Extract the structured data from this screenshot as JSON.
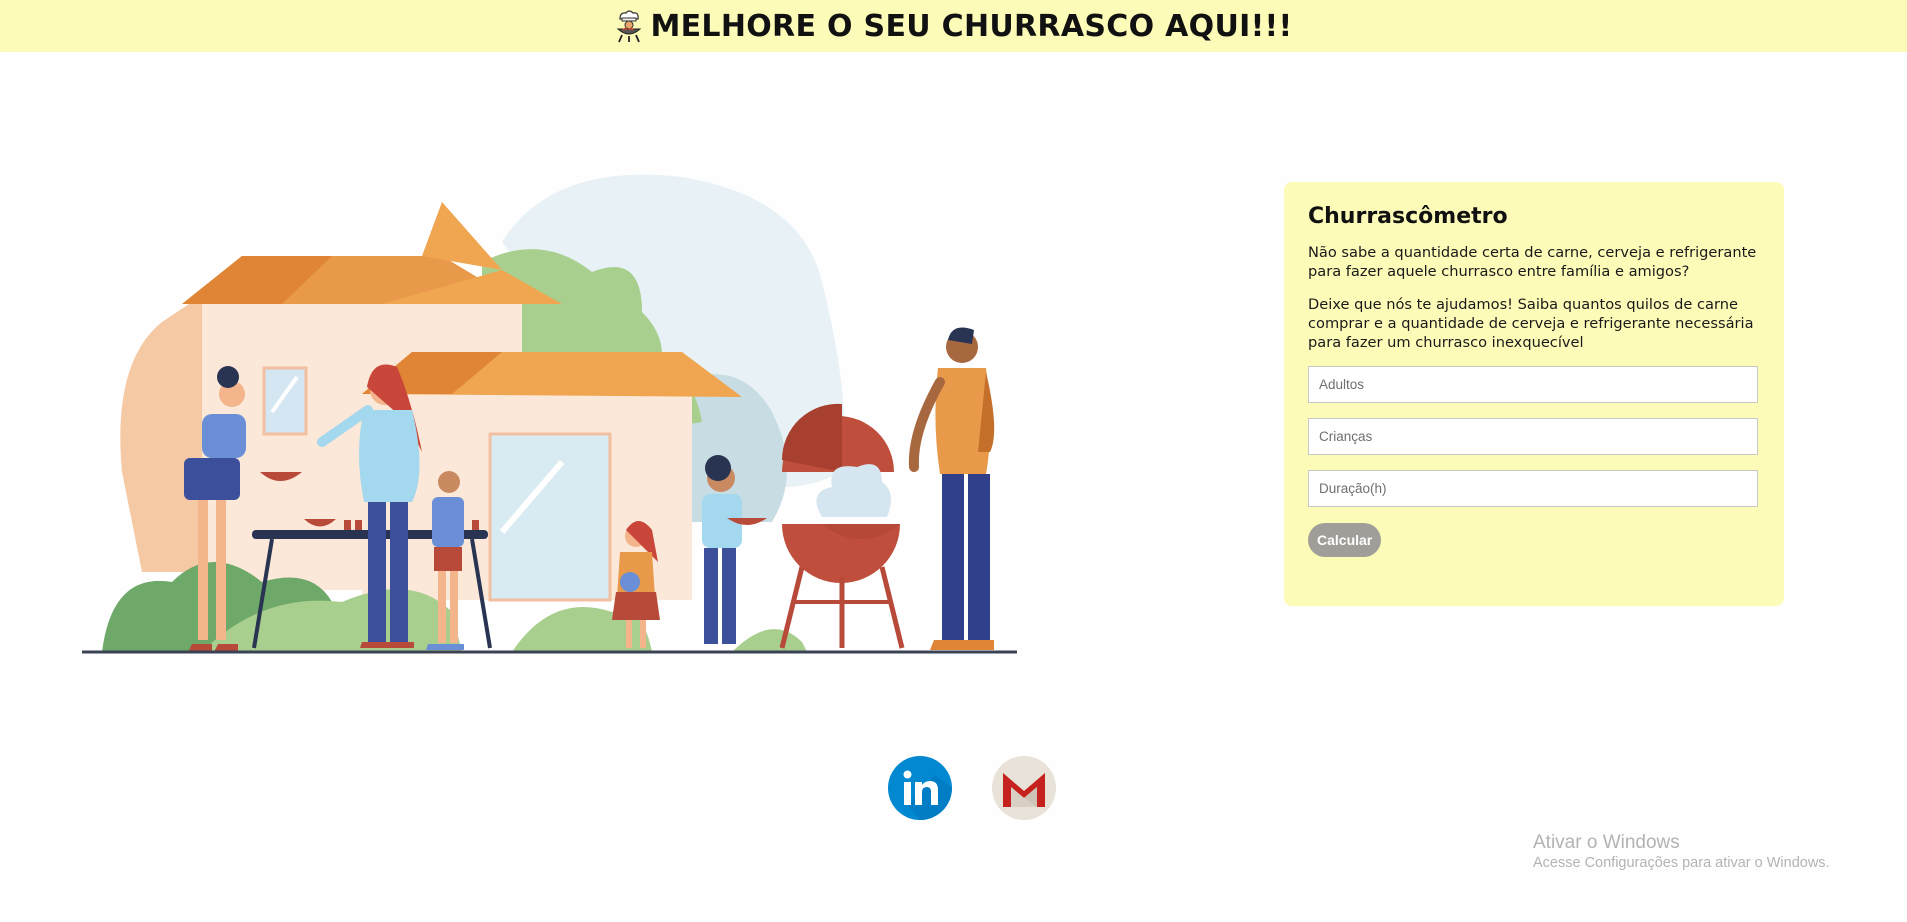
{
  "header": {
    "title": "MELHORE O SEU CHURRASCO AQUI!!!",
    "logo_icon": "grill-chef-icon",
    "background": "#fdfbb8"
  },
  "illustration": {
    "icon": "family-barbecue-illustration"
  },
  "form": {
    "title": "Churrascômetro",
    "intro": "Não sabe a quantidade certa de carne, cerveja e refrigerante para fazer aquele churrasco entre família e amigos?",
    "description": "Deixe que nós te ajudamos! Saiba quantos quilos de carne comprar e a quantidade de cerveja e refrigerante necessária para fazer um churrasco inexquecível",
    "fields": {
      "adults": {
        "placeholder": "Adultos",
        "value": ""
      },
      "children": {
        "placeholder": "Crianças",
        "value": ""
      },
      "duration": {
        "placeholder": "Duração(h)",
        "value": ""
      }
    },
    "submit_label": "Calcular",
    "background": "#fdfbb8"
  },
  "social": {
    "linkedin_icon": "linkedin-icon",
    "linkedin_color": "#0288d1",
    "gmail_icon": "gmail-icon",
    "gmail_color": "#c5221f"
  },
  "watermark": {
    "line1": "Ativar o Windows",
    "line2": "Acesse Configurações para ativar o Windows."
  }
}
